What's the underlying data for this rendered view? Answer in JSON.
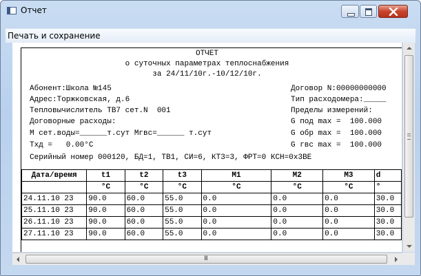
{
  "window": {
    "title": "Отчет"
  },
  "menu": {
    "items": [
      "Печать и сохранение"
    ]
  },
  "report": {
    "title": "ОТЧЕТ",
    "subtitle": "о суточных параметрах теплоснабжения",
    "period": "за 24/11/10г.-10/12/10г.",
    "left_lines": [
      "Абонент:Школа №145",
      "Адрес:Торжковская, д.6",
      "Тепловычислитель ТВ7 сет.N  001",
      "Договорные расходы:",
      "М сет.воды=______т.сут Мгвс=______ т.сут",
      "Тхд =   0.00°С"
    ],
    "right_lines": [
      "Договор N:00000000000",
      "Тип расходомера:_____",
      "Пределы измерений:",
      "",
      "G обр max =  100.000",
      "G гвс max =  100.000"
    ],
    "right_line_gpod": "G под max =  100.000",
    "serial_line": "Серийный номер 000120, БД=1, ТВ1, СИ=6, КТ3=3, ФРТ=0 КСН=0x3BE"
  },
  "table": {
    "headers": [
      "Дата/время",
      "t1",
      "t2",
      "t3",
      "M1",
      "M2",
      "M3",
      "d"
    ],
    "units": [
      "",
      "°C",
      "°C",
      "°C",
      "°C",
      "°C",
      "°C",
      "°"
    ],
    "rows": [
      [
        "24.11.10 23",
        "90.0",
        "60.0",
        "55.0",
        "0.0",
        "0.0",
        "0.0",
        "30.0"
      ],
      [
        "25.11.10 23",
        "90.0",
        "60.0",
        "55.0",
        "0.0",
        "0.0",
        "0.0",
        "30.0"
      ],
      [
        "26.11.10 23",
        "90.0",
        "60.0",
        "55.0",
        "0.0",
        "0.0",
        "0.0",
        "30.0"
      ],
      [
        "27.11.10 23",
        "90.0",
        "60.0",
        "55.0",
        "0.0",
        "0.0",
        "0.0",
        "30.0"
      ]
    ]
  },
  "scrollbar": {
    "grip": "III"
  }
}
